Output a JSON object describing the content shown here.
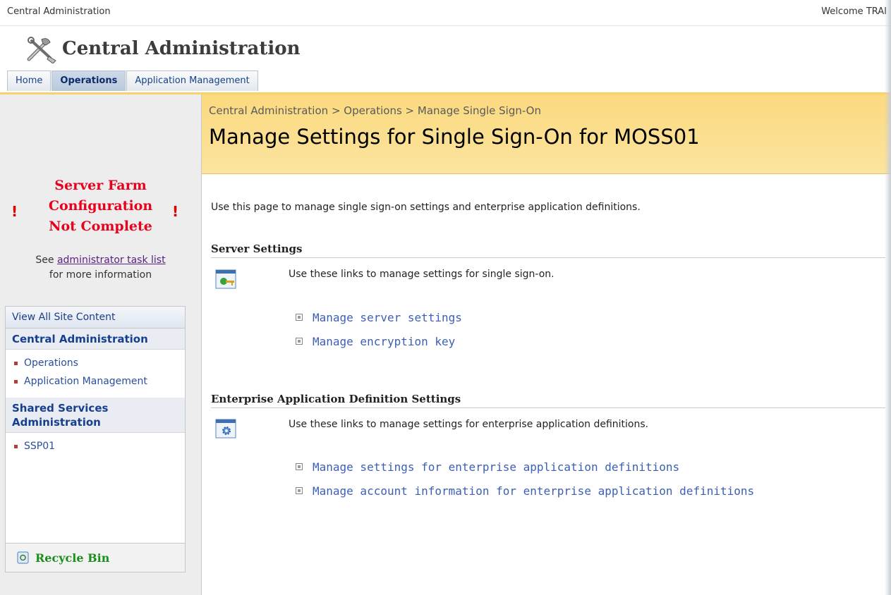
{
  "top_bar": {
    "site_name": "Central Administration",
    "welcome": "Welcome TRAI"
  },
  "header": {
    "title": "Central Administration"
  },
  "tabs": [
    {
      "label": "Home",
      "active": false
    },
    {
      "label": "Operations",
      "active": true
    },
    {
      "label": "Application Management",
      "active": false
    }
  ],
  "warning": {
    "line1": "Server Farm",
    "line2": "Configuration",
    "line3": "Not Complete",
    "see": "See",
    "link": "administrator task list",
    "more": "for more information"
  },
  "quick_launch": {
    "view_all": "View All Site Content",
    "groups": [
      {
        "heading": "Central Administration",
        "items": [
          "Operations",
          "Application Management"
        ]
      },
      {
        "heading": "Shared Services Administration",
        "items": [
          "SSP01"
        ]
      }
    ],
    "recycle_bin": "Recycle Bin"
  },
  "breadcrumb": {
    "root": "Central Administration",
    "sep": ">",
    "middle": "Operations",
    "current": "Manage Single Sign-On"
  },
  "page_title": "Manage Settings for Single Sign-On for MOSS01",
  "intro": "Use this page to manage single sign-on settings and enterprise application definitions.",
  "sections": [
    {
      "heading": "Server Settings",
      "description": "Use these links to manage settings for single sign-on.",
      "links": [
        "Manage server settings",
        "Manage encryption key"
      ]
    },
    {
      "heading": "Enterprise Application Definition Settings",
      "description": "Use these links to manage settings for enterprise application definitions.",
      "links": [
        "Manage settings for enterprise application definitions",
        "Manage account information for enterprise application definitions"
      ]
    }
  ],
  "colors": {
    "accent": "#f7d26a",
    "warning": "#e8001c",
    "link": "#3b5fb5",
    "nav": "#15428b"
  }
}
